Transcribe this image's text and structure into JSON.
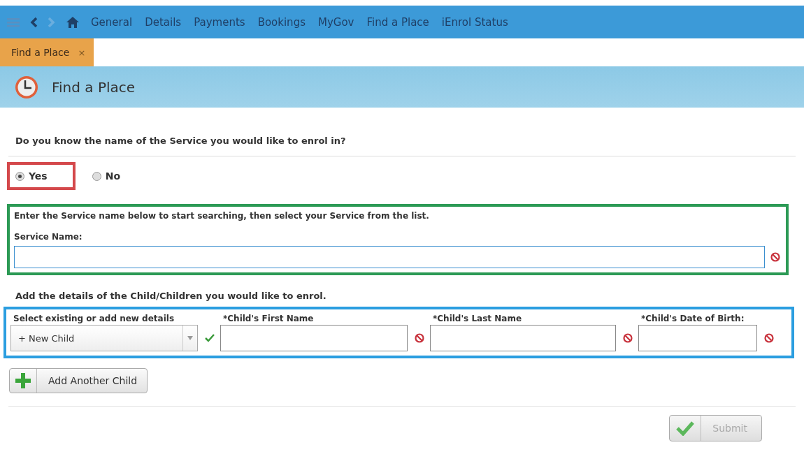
{
  "nav": {
    "items": [
      "General",
      "Details",
      "Payments",
      "Bookings",
      "MyGov",
      "Find a Place",
      "iEnrol Status"
    ]
  },
  "tabs": [
    {
      "label": "Find a Place",
      "close": "×",
      "selected": true
    }
  ],
  "page_header": {
    "title": "Find a Place"
  },
  "question": "Do you know the name of the Service you would like to enrol in?",
  "options": [
    {
      "label": "Yes",
      "selected": true
    },
    {
      "label": "No",
      "selected": false
    }
  ],
  "service_section": {
    "instruction": "Enter the Service name below to start searching, then select your Service from the list.",
    "field_label": "Service Name:"
  },
  "children_heading": "Add the details of the Child/Children you would like to enrol.",
  "child_row": {
    "select_label": "Select existing or add new details",
    "select_value": "+ New Child",
    "fields": [
      "*Child's First Name",
      "*Child's Last Name",
      "*Child's Date of Birth:"
    ]
  },
  "add_button": "Add Another Child",
  "submit": {
    "label": "Submit",
    "disabled": true
  }
}
